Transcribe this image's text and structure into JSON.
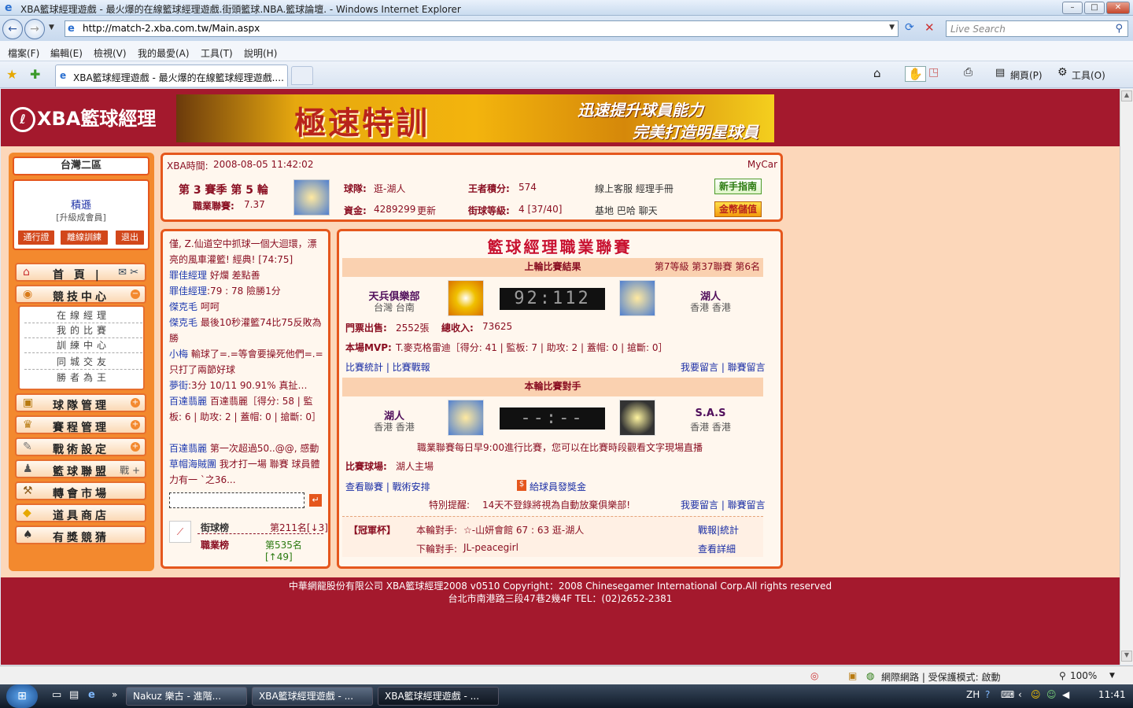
{
  "window": {
    "title": "XBA籃球經理遊戲 - 最火爆的在線籃球經理遊戲.街頭籃球.NBA.籃球論壇. - Windows Internet Explorer",
    "minimize": "–",
    "maximize": "□",
    "close": "✕"
  },
  "address": {
    "url": "http://match-2.xba.com.tw/Main.aspx",
    "search_placeholder": "Live Search"
  },
  "menu": [
    "檔案(F)",
    "編輯(E)",
    "檢視(V)",
    "我的最愛(A)",
    "工具(T)",
    "說明(H)"
  ],
  "tab": {
    "title": "XBA籃球經理遊戲 - 最火爆的在線籃球經理遊戲....",
    "page_label": "網頁(P)",
    "tools_label": "工具(O)"
  },
  "site": {
    "logo": "XBA籃球經理",
    "banner_title": "極速特訓",
    "banner_line1": "迅速提升球員能力",
    "banner_line2": "完美打造明星球員"
  },
  "sidebar": {
    "area": "台灣二區",
    "username": "積遜",
    "member_link": "[升級成會員]",
    "buttons": [
      "通行證",
      "離線訓練",
      "退出"
    ],
    "menu": [
      {
        "icon": "⌂",
        "label": "首 頁 |",
        "extra": "✉ ✂"
      },
      {
        "icon": "◉",
        "label": "競技中心",
        "extra": "−"
      },
      {
        "icon": "▣",
        "label": "球隊管理",
        "extra": "+"
      },
      {
        "icon": "♛",
        "label": "賽程管理",
        "extra": "+"
      },
      {
        "icon": "✎",
        "label": "戰術設定",
        "extra": "+"
      },
      {
        "icon": "♟",
        "label": "籃球聯盟",
        "extra": "戰 +"
      },
      {
        "icon": "⚒",
        "label": "轉會市場",
        "extra": ""
      },
      {
        "icon": "◆",
        "label": "道具商店",
        "extra": ""
      },
      {
        "icon": "♠",
        "label": "有獎競猜",
        "extra": ""
      }
    ],
    "submenu": [
      "在線經理",
      "我的比賽",
      "訓練中心",
      "同城交友",
      "勝者為王"
    ]
  },
  "info": {
    "time_label": "XBA時間:",
    "time": "2008-08-05 11:42:02",
    "mycar": "MyCar",
    "season": "第 3 賽季 第 5 輪",
    "pro_label": "職業聯賽:",
    "pro_value": "7.37",
    "team_label": "球隊:",
    "team_value": "逛-湖人",
    "funds_label": "資金:",
    "funds_value": "4289299",
    "update": "更新",
    "king_label": "王者積分:",
    "king_value": "574",
    "street_label": "街球等級:",
    "street_value": "4 [37/40]",
    "links1": "線上客服  經理手冊",
    "links2": "基地  巴哈  聊天",
    "guide_btn": "新手指南",
    "coin_btn": "金幣儲值"
  },
  "chat": {
    "messages": [
      {
        "name": "",
        "text": "僅, Z.仙道空中抓球一個大迴環，漂亮的風車灌籃! 經典!  [74:75]"
      },
      {
        "name": "罪佳經理",
        "text": " 好爛 差點善"
      },
      {
        "name": "罪佳經理",
        "text": ":79 : 78 險勝1分"
      },
      {
        "name": "傑克毛",
        "text": " 呵呵"
      },
      {
        "name": "傑克毛",
        "text": " 最後10秒灌籃74比75反敗為勝"
      },
      {
        "name": "小梅",
        "text": " 輸球了=.=等會要操死他們=.=只打了兩節好球"
      },
      {
        "name": "夢街",
        "text": ":3分 10/11 90.91% 真扯…"
      },
      {
        "name": "百達翡麗",
        "text": " 百達翡麗［得分: 58 | 監板: 6 | 助攻: 2 | 蓋帽: 0 | 搶斷: 0］"
      },
      {
        "name": "百達翡麗",
        "text": " 第一次超過50..@@, 感動"
      },
      {
        "name": "草帽海賊團",
        "text": " 我才打一場 聯賽 球員體力有一 `之36..."
      }
    ],
    "rank1_label": "街球榜",
    "rank1_value": "第211名[↓3]",
    "rank2_label": "職業榜",
    "rank2_value": "第535名[↑49]"
  },
  "match": {
    "title": "籃球經理職業聯賽",
    "last_header": "上輪比賽結果",
    "last_rank": "第7等級 第37聯賽 第6名",
    "home_name": "天兵俱樂部",
    "home_loc": "台灣 台南",
    "score": "92:112",
    "away_name": "湖人",
    "away_loc": "香港 香港",
    "tickets_label": "門票出售:",
    "tickets_value": "2552張",
    "revenue_label": "總收入:",
    "revenue_value": "73625",
    "mvp_label": "本場MVP:",
    "mvp_value": "T.麥克格雷迪［得分: 41 | 監板: 7 | 助攻: 2 | 蓋帽: 0 | 搶斷: 0］",
    "stats_links": "比賽統計 | 比賽戰報",
    "msg_links": "我要留言 | 聯賽留言",
    "next_header": "本輪比賽對手",
    "next_home_name": "湖人",
    "next_home_loc": "香港 香港",
    "next_score": "--:--",
    "next_away_name": "S.A.S",
    "next_away_loc": "香港 香港",
    "schedule_note": "職業聯賽每日早9:00進行比賽，您可以在比賽時段觀看文字現場直播",
    "venue_label": "比賽球場:",
    "venue_value": "湖人主場",
    "view_links": "查看聯賽 | 戰術安排",
    "bonus": "給球員發獎金",
    "warn_label": "特別提醒:",
    "warn_text": "14天不登錄將視為自動放棄俱樂部!",
    "msg_links2": "我要留言 | 聯賽留言",
    "cup_label": "【冠軍杯】",
    "cup_this_label": "本輪對手:",
    "cup_this_value": "☆-山妍會館  67 : 63 逛-湖人",
    "cup_next_label": "下輪對手:",
    "cup_next_value": "JL-peacegirl",
    "cup_link1": "戰報|統計",
    "cup_link2": "查看詳細"
  },
  "footer": {
    "line1": "中華網龍股份有限公司  XBA籃球經理2008 v0510     Copyright：2008 Chinesegamer International Corp.All rights reserved",
    "line2": "台北市南港路三段47巷2幾4F TEL：(02)2652-2381"
  },
  "status": {
    "zone": "網際網路 | 受保護模式: 啟動",
    "zoom": "100%"
  },
  "taskbar": {
    "tasks": [
      "Nakuz 樂古 - 進階...",
      "XBA籃球經理遊戲 - ...",
      "XBA籃球經理遊戲 - ..."
    ],
    "lang": "ZH",
    "clock": "11:41"
  },
  "colors": {
    "page_red": "#a4192d",
    "panel_orange": "#f3892e",
    "content_bg": "#fcd7ba",
    "dark_red_text": "#8a0f22",
    "link_blue": "#1a2ea5"
  }
}
